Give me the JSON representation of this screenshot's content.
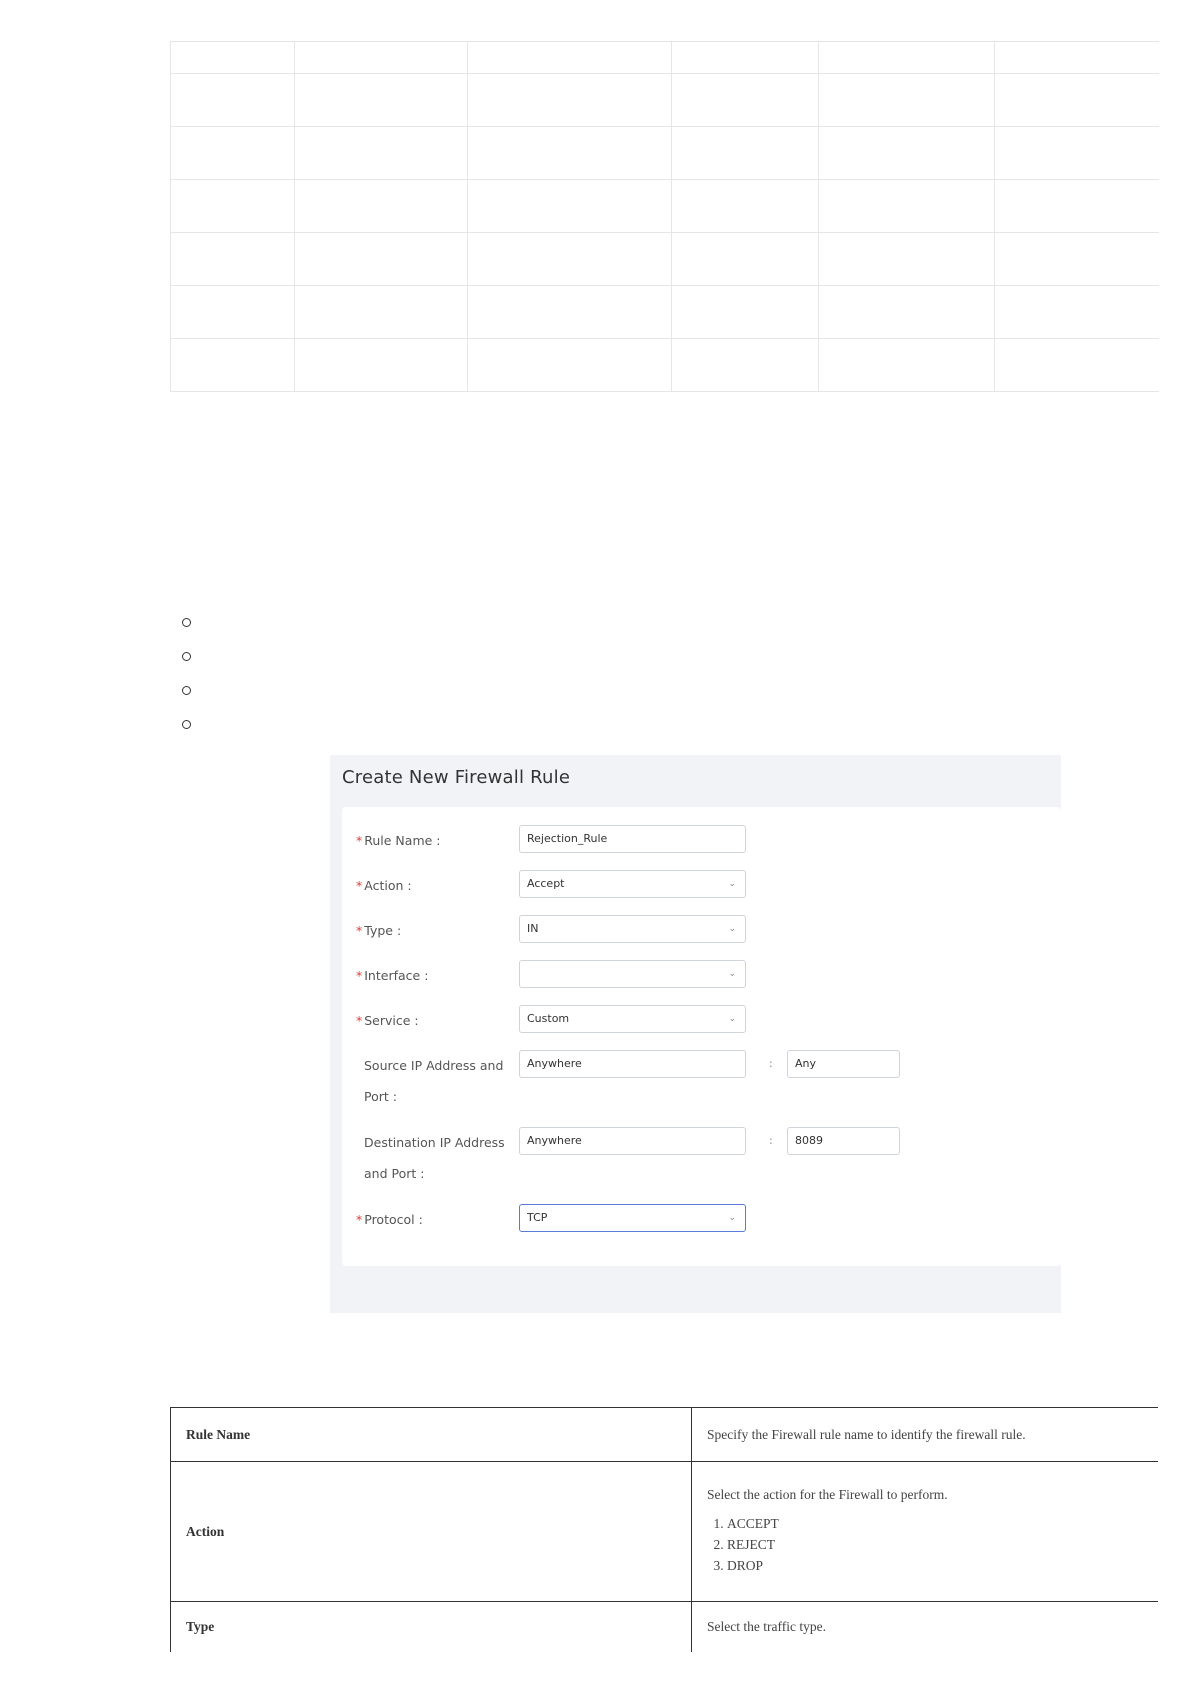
{
  "top_table": {
    "columns": 6,
    "rows": 7
  },
  "bullets": [
    "",
    "",
    "",
    ""
  ],
  "panel": {
    "title": "Create New Firewall Rule",
    "fields": {
      "rule_name": {
        "label": "Rule Name",
        "value": "Rejection_Rule",
        "required": true
      },
      "action": {
        "label": "Action",
        "value": "Accept",
        "required": true
      },
      "type": {
        "label": "Type",
        "value": "IN",
        "required": true
      },
      "interface": {
        "label": "Interface",
        "value": "",
        "required": true
      },
      "service": {
        "label": "Service",
        "value": "Custom",
        "required": true
      },
      "source": {
        "label_line1": "Source IP Address and",
        "label_line2": "Port",
        "address": "Anywhere",
        "port": "Any"
      },
      "destination": {
        "label_line1": "Destination IP Address",
        "label_line2": "and Port",
        "address": "Anywhere",
        "port": "8089"
      },
      "protocol": {
        "label": "Protocol",
        "value": "TCP",
        "required": true
      }
    },
    "separator": ":",
    "required_mark": "*",
    "chevron": "⌄"
  },
  "definitions": [
    {
      "term": "Rule Name",
      "description": "Specify the Firewall rule name to identify the firewall rule."
    },
    {
      "term": "Action",
      "description": "Select the action for the Firewall to perform.",
      "options": [
        "ACCEPT",
        "REJECT",
        "DROP"
      ]
    },
    {
      "term": "Type",
      "description": "Select the traffic type."
    }
  ]
}
